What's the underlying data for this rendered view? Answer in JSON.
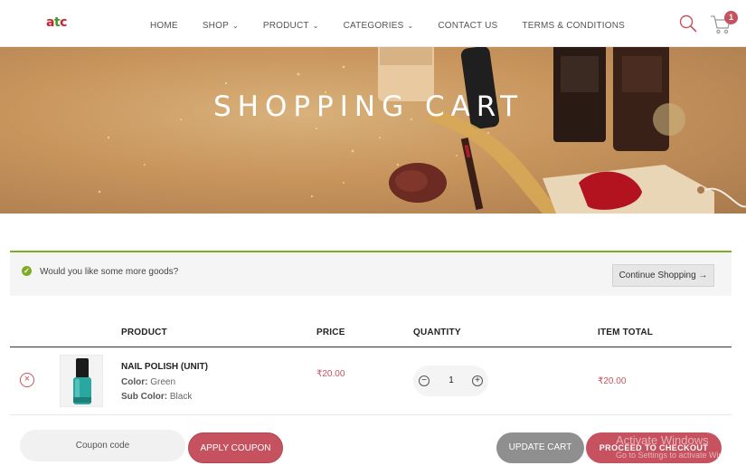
{
  "brand": {
    "logo_parts": [
      "a",
      "t",
      "c"
    ]
  },
  "nav": {
    "items": [
      {
        "label": "HOME",
        "has_dropdown": false
      },
      {
        "label": "SHOP",
        "has_dropdown": true
      },
      {
        "label": "PRODUCT",
        "has_dropdown": true
      },
      {
        "label": "CATEGORIES",
        "has_dropdown": true
      },
      {
        "label": "CONTACT US",
        "has_dropdown": false
      },
      {
        "label": "TERMS & CONDITIONS",
        "has_dropdown": false
      }
    ],
    "cart_count": "1"
  },
  "hero": {
    "title": "SHOPPING CART"
  },
  "notice": {
    "message": "Would you like some more goods?",
    "continue_label": "Continue Shopping →"
  },
  "table": {
    "headers": {
      "product": "PRODUCT",
      "price": "PRICE",
      "quantity": "QUANTITY",
      "item_total": "ITEM TOTAL"
    },
    "rows": [
      {
        "name": "NAIL POLISH (UNIT)",
        "color_label": "Color:",
        "color_value": "Green",
        "sub_color_label": "Sub Color:",
        "sub_color_value": "Black",
        "price": "₹20.00",
        "quantity": "1",
        "item_total": "₹20.00"
      }
    ]
  },
  "actions": {
    "coupon_placeholder": "Coupon code",
    "apply_coupon": "APPLY COUPON",
    "update_cart": "UPDATE CART",
    "proceed_checkout": "PROCEED TO CHECKOUT"
  },
  "os_watermark": {
    "line1": "Activate Windows",
    "line2": "Go to Settings to activate Windows."
  },
  "colors": {
    "accent": "#c6525f",
    "notice_border": "#7fac24",
    "update_button": "#8f8f8f"
  }
}
